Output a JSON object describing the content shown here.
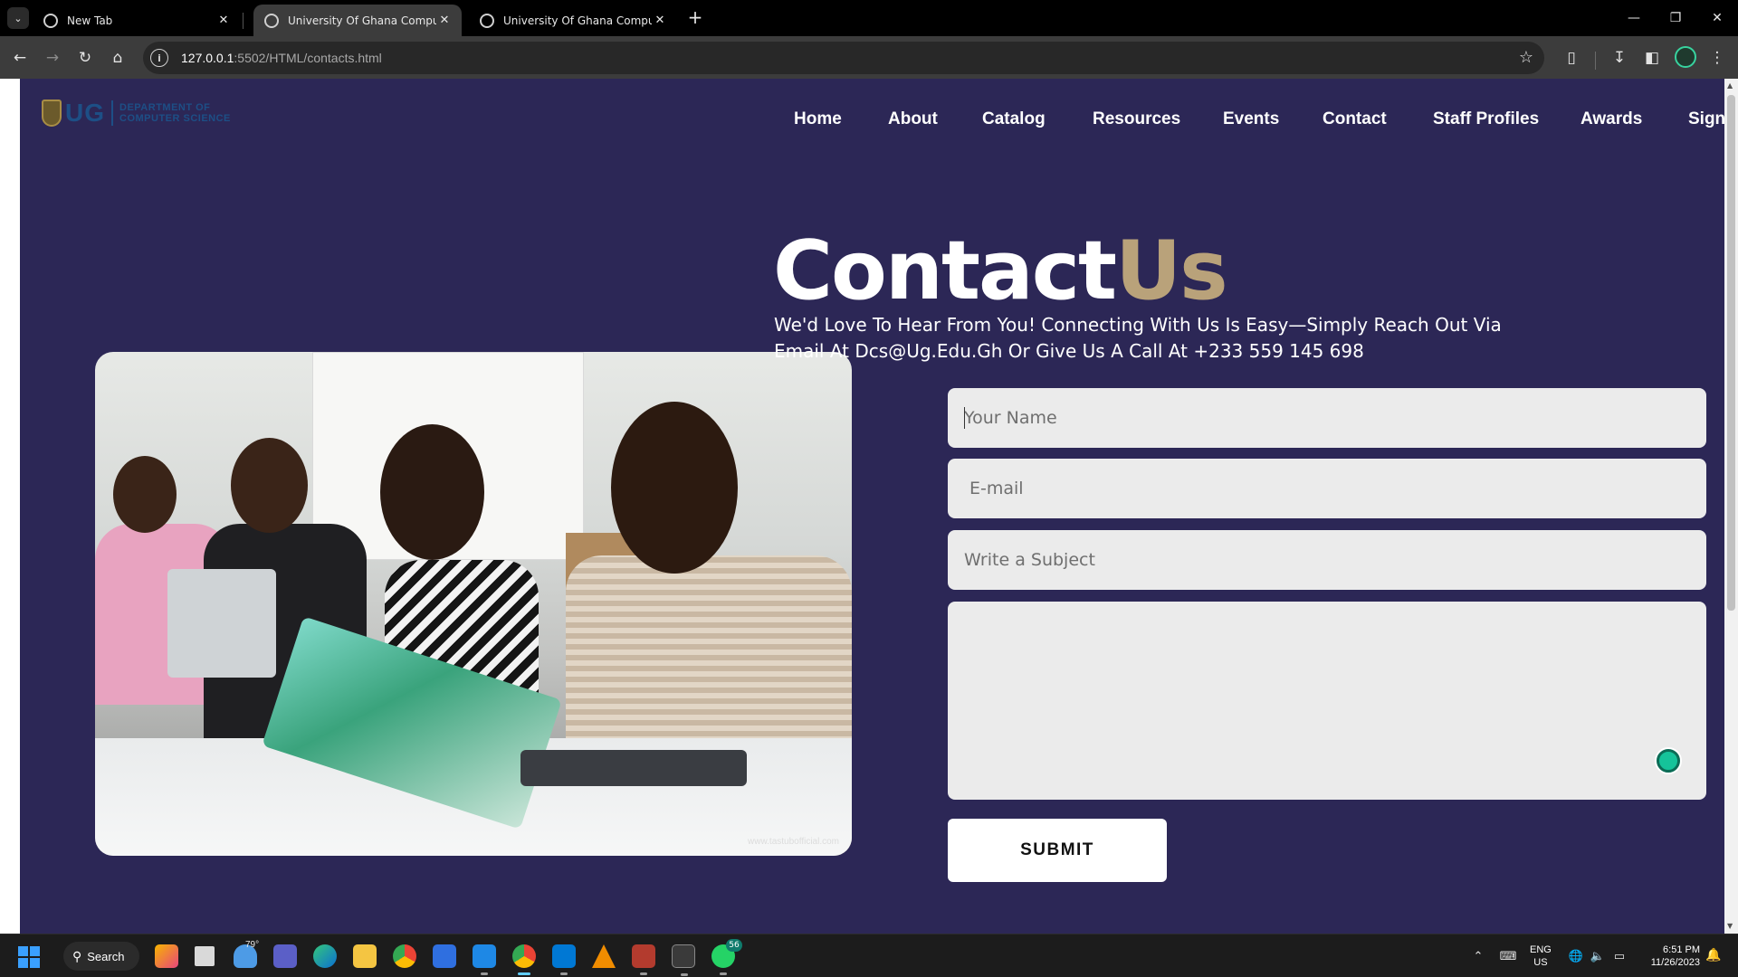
{
  "browser": {
    "tabs": [
      {
        "title": "New Tab",
        "active": false
      },
      {
        "title": "University Of Ghana Computer",
        "active": true
      },
      {
        "title": "University Of Ghana Computer",
        "active": false
      }
    ],
    "url_host": "127.0.0.1",
    "url_path": ":5502/HTML/contacts.html",
    "icons": {
      "tab_menu": "chevron-down-icon",
      "new_tab": "plus-icon",
      "back": "arrow-left-icon",
      "forward": "arrow-right-icon",
      "reload": "reload-icon",
      "home": "home-icon",
      "site_info": "info-icon",
      "bookmark": "star-icon",
      "extensions": "puzzle-icon",
      "downloads": "download-icon",
      "side_panel": "side-panel-icon",
      "menu": "kebab-icon"
    }
  },
  "site": {
    "logo": {
      "short": "UG",
      "line1": "DEPARTMENT OF",
      "line2": "COMPUTER SCIENCE"
    },
    "nav": [
      "Home",
      "About",
      "Catalog",
      "Resources",
      "Events",
      "Contact",
      "Staff Profiles",
      "Awards",
      "Sign"
    ],
    "heading_main": "Contact",
    "heading_accent": "Us",
    "subtitle": "We'd Love To Hear From You! Connecting With Us Is Easy—Simply Reach Out Via Email At Dcs@Ug.Edu.Gh Or Give Us A Call At +233 559 145 698",
    "form": {
      "name_placeholder": "Your Name",
      "email_placeholder": "E-mail",
      "subject_placeholder": "Write a Subject",
      "message_placeholder": "",
      "submit_label": "SUBMIT"
    },
    "photo_watermark": "www.tastubofficial.com",
    "colors": {
      "background": "#2c2756",
      "accent": "#b9a27a",
      "field": "#ebebeb"
    }
  },
  "taskbar": {
    "search_label": "Search",
    "weather_temp": "79°",
    "whatsapp_badge": "56",
    "lang_line1": "ENG",
    "lang_line2": "US",
    "time": "6:51 PM",
    "date": "11/26/2023"
  }
}
